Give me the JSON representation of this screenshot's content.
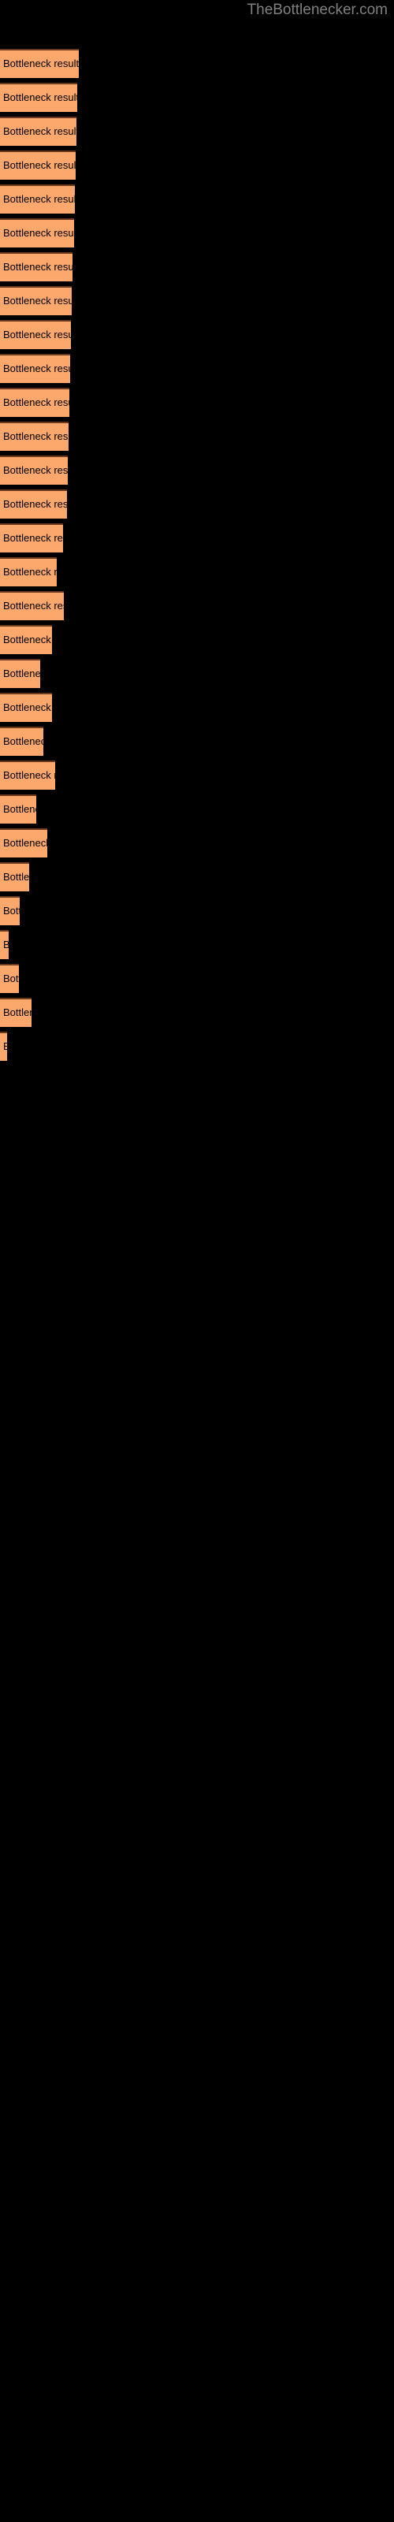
{
  "header": {
    "site_title": "TheBottlenecker.com"
  },
  "colors": {
    "background": "#000000",
    "bar_fill": "#fca86c",
    "bar_border_top": "#6b3a1e",
    "title_text": "#808080",
    "label_text": "#000000"
  },
  "chart_data": {
    "type": "bar",
    "orientation": "horizontal",
    "title": "TheBottlenecker.com",
    "xlabel": "",
    "ylabel": "",
    "grid": false,
    "legend": false,
    "bar_label_text": "Bottleneck result",
    "categories": [
      "Bottleneck result",
      "Bottleneck result",
      "Bottleneck result",
      "Bottleneck result",
      "Bottleneck result",
      "Bottleneck result",
      "Bottleneck result",
      "Bottleneck result",
      "Bottleneck result",
      "Bottleneck result",
      "Bottleneck result",
      "Bottleneck result",
      "Bottleneck result",
      "Bottleneck result",
      "Bottleneck result",
      "Bottleneck result",
      "Bottleneck result",
      "Bottleneck result",
      "Bottleneck result",
      "Bottleneck result",
      "Bottleneck result",
      "Bottleneck result",
      "Bottleneck result",
      "Bottleneck result",
      "Bottleneck result",
      "Bottleneck result",
      "Bottleneck result",
      "Bottleneck result",
      "Bottleneck result",
      "Bottleneck result"
    ],
    "values": [
      100,
      98,
      97,
      96,
      95,
      94,
      92,
      91,
      90,
      89,
      88,
      87,
      86,
      85,
      80,
      72,
      81,
      66,
      51,
      66,
      55,
      70,
      46,
      60,
      37,
      25,
      11,
      24,
      40,
      9
    ],
    "xlim": [
      0,
      100
    ],
    "bars": [
      {
        "index": 0,
        "y": 62,
        "width": 100,
        "label": "Bottleneck result"
      },
      {
        "index": 1,
        "y": 105,
        "width": 98,
        "label": "Bottleneck result"
      },
      {
        "index": 2,
        "y": 148,
        "width": 97,
        "label": "Bottleneck result"
      },
      {
        "index": 3,
        "y": 191,
        "width": 96,
        "label": "Bottleneck result"
      },
      {
        "index": 4,
        "y": 234,
        "width": 95,
        "label": "Bottleneck result"
      },
      {
        "index": 5,
        "y": 277,
        "width": 94,
        "label": "Bottleneck result"
      },
      {
        "index": 6,
        "y": 320,
        "width": 92,
        "label": "Bottleneck result"
      },
      {
        "index": 7,
        "y": 363,
        "width": 91,
        "label": "Bottleneck result"
      },
      {
        "index": 8,
        "y": 406,
        "width": 90,
        "label": "Bottleneck result"
      },
      {
        "index": 9,
        "y": 449,
        "width": 89,
        "label": "Bottleneck result"
      },
      {
        "index": 10,
        "y": 492,
        "width": 88,
        "label": "Bottleneck result"
      },
      {
        "index": 11,
        "y": 535,
        "width": 87,
        "label": "Bottleneck result"
      },
      {
        "index": 12,
        "y": 578,
        "width": 86,
        "label": "Bottleneck result"
      },
      {
        "index": 13,
        "y": 621,
        "width": 85,
        "label": "Bottleneck result"
      },
      {
        "index": 14,
        "y": 664,
        "width": 80,
        "label": "Bottleneck result"
      },
      {
        "index": 15,
        "y": 707,
        "width": 72,
        "label": "Bottleneck result"
      },
      {
        "index": 16,
        "y": 750,
        "width": 81,
        "label": "Bottleneck result"
      },
      {
        "index": 17,
        "y": 793,
        "width": 66,
        "label": "Bottleneck result"
      },
      {
        "index": 18,
        "y": 836,
        "width": 51,
        "label": "Bottleneck result"
      },
      {
        "index": 19,
        "y": 879,
        "width": 66,
        "label": "Bottleneck result"
      },
      {
        "index": 20,
        "y": 922,
        "width": 55,
        "label": "Bottleneck result"
      },
      {
        "index": 21,
        "y": 965,
        "width": 70,
        "label": "Bottleneck result"
      },
      {
        "index": 22,
        "y": 1008,
        "width": 46,
        "label": "Bottleneck result"
      },
      {
        "index": 23,
        "y": 1051,
        "width": 60,
        "label": "Bottleneck result"
      },
      {
        "index": 24,
        "y": 1094,
        "width": 37,
        "label": "Bottleneck result"
      },
      {
        "index": 25,
        "y": 1137,
        "width": 25,
        "label": "Bottleneck result"
      },
      {
        "index": 26,
        "y": 1180,
        "width": 11,
        "label": "Bottleneck result"
      },
      {
        "index": 27,
        "y": 1223,
        "width": 24,
        "label": "Bottleneck result"
      },
      {
        "index": 28,
        "y": 1266,
        "width": 40,
        "label": "Bottleneck result"
      },
      {
        "index": 29,
        "y": 1309,
        "width": 9,
        "label": "Bottleneck result"
      }
    ]
  }
}
